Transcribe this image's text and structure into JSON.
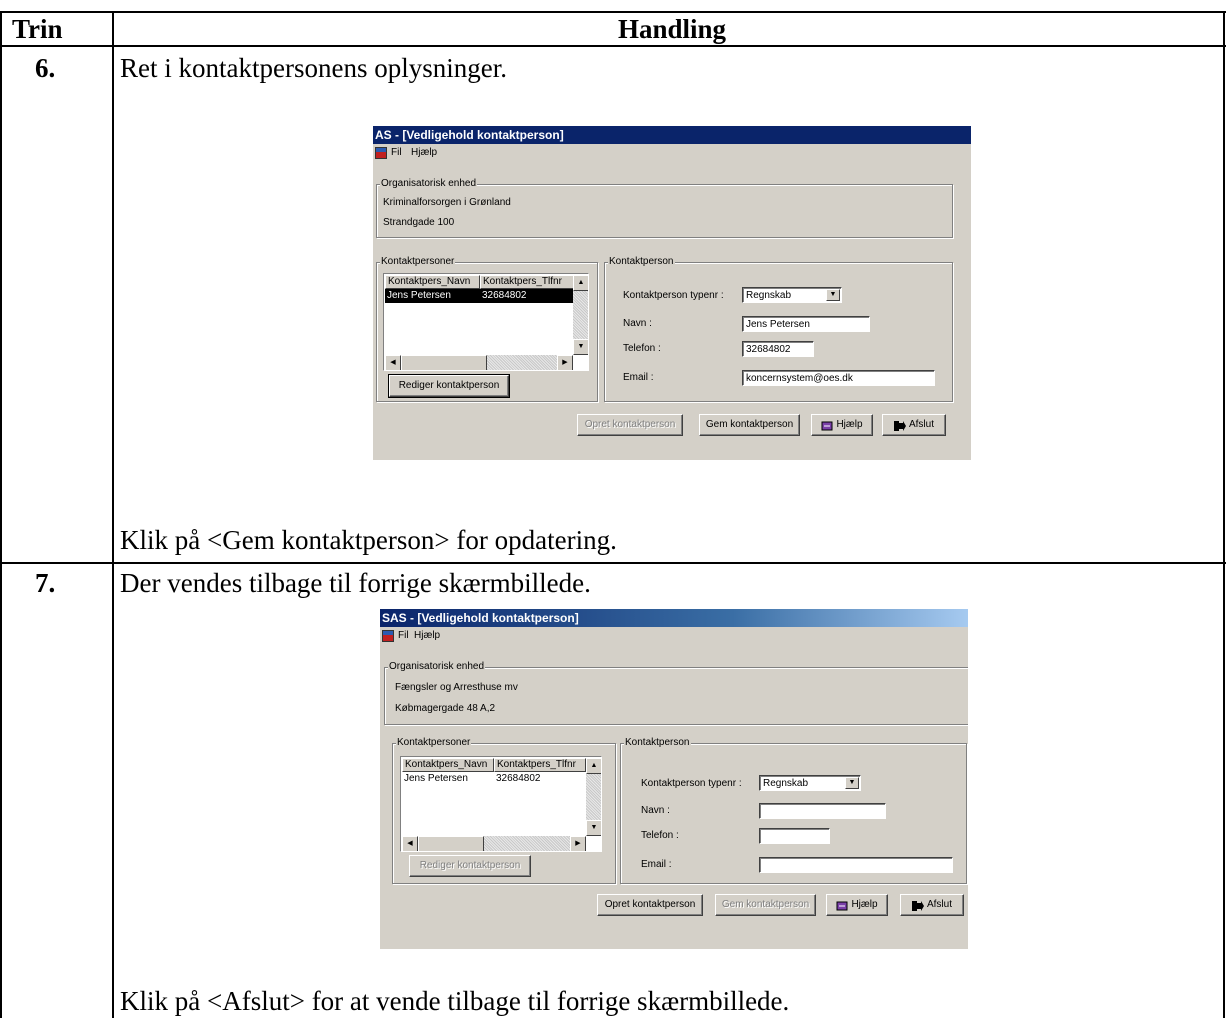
{
  "table": {
    "header_step": "Trin",
    "header_action": "Handling"
  },
  "rows": [
    {
      "step": "6.",
      "intro": "Ret i kontaktpersonens oplysninger.",
      "outro": "Klik på <Gem kontaktperson> for opdatering."
    },
    {
      "step": "7.",
      "intro": "Der vendes tilbage til forrige skærmbillede.",
      "outro": "Klik på <Afslut> for at vende tilbage til forrige skærmbillede."
    }
  ],
  "screen1": {
    "title": "AS - [Vedligehold kontaktperson]",
    "menu_fil": "Fil",
    "menu_hjaelp": "Hjælp",
    "org_group": "Organisatorisk enhed",
    "org_name": "Kriminalforsorgen i Grønland",
    "org_address": "Strandgade 100",
    "contacts_group": "Kontaktpersoner",
    "col_name": "Kontaktpers_Navn",
    "col_phone": "Kontaktpers_Tlfnr",
    "row_name": "Jens Petersen",
    "row_phone": "32684802",
    "edit_button": "Rediger kontaktperson",
    "contact_group": "Kontaktperson",
    "type_label": "Kontaktperson typenr :",
    "type_value": "Regnskab",
    "name_label": "Navn :",
    "name_value": "Jens Petersen",
    "phone_label": "Telefon :",
    "phone_value": "32684802",
    "email_label": "Email :",
    "email_value": "koncernsystem@oes.dk",
    "create_button": "Opret kontaktperson",
    "save_button": "Gem kontaktperson",
    "help_button": "Hjælp",
    "exit_button": "Afslut"
  },
  "screen2": {
    "title": "SAS - [Vedligehold kontaktperson]",
    "menu_fil": "Fil",
    "menu_hjaelp": "Hjælp",
    "org_group": "Organisatorisk enhed",
    "org_name": "Fængsler og Arresthuse mv",
    "org_address": "Købmagergade 48 A,2",
    "contacts_group": "Kontaktpersoner",
    "col_name": "Kontaktpers_Navn",
    "col_phone": "Kontaktpers_Tlfnr",
    "row_name": "Jens Petersen",
    "row_phone": "32684802",
    "edit_button": "Rediger kontaktperson",
    "contact_group": "Kontaktperson",
    "type_label": "Kontaktperson typenr :",
    "type_value": "Regnskab",
    "name_label": "Navn :",
    "name_value": "",
    "phone_label": "Telefon :",
    "phone_value": "",
    "email_label": "Email :",
    "email_value": "",
    "create_button": "Opret kontaktperson",
    "save_button": "Gem kontaktperson",
    "help_button": "Hjælp",
    "exit_button": "Afslut"
  },
  "colors": {
    "titlebar_start": "#0a246a",
    "titlebar_end": "#a6caf0",
    "selection": "#000000",
    "dialog_bg": "#d4d0c8"
  }
}
